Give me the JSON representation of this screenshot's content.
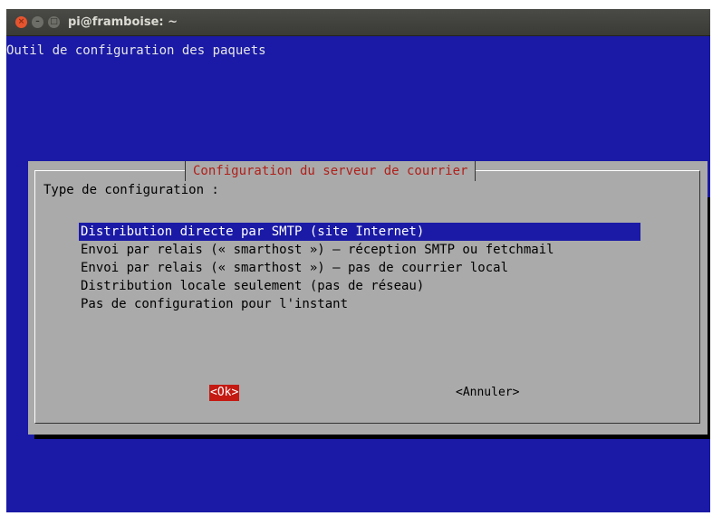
{
  "window": {
    "title": "pi@framboise: ~",
    "buttons": {
      "close": "×",
      "minimize": "–",
      "maximize": "□"
    }
  },
  "terminal": {
    "backtitle": "Outil de configuration des paquets"
  },
  "dialog": {
    "title": "Configuration du serveur de courrier",
    "prompt": "Type de configuration :",
    "items": [
      {
        "label": "Distribution directe par SMTP (site Internet)",
        "selected": true
      },
      {
        "label": "Envoi par relais (« smarthost ») — réception SMTP ou fetchmail",
        "selected": false
      },
      {
        "label": "Envoi par relais (« smarthost ») — pas de courrier local",
        "selected": false
      },
      {
        "label": "Distribution locale seulement (pas de réseau)",
        "selected": false
      },
      {
        "label": "Pas de configuration pour l'instant",
        "selected": false
      }
    ],
    "ok_label": "<Ok>",
    "cancel_label": "<Annuler>"
  },
  "colors": {
    "terminal_bg": "#1a1aa6",
    "dialog_bg": "#aaaaaa",
    "title_red": "#b0201a",
    "ok_bg": "#c41a12"
  }
}
